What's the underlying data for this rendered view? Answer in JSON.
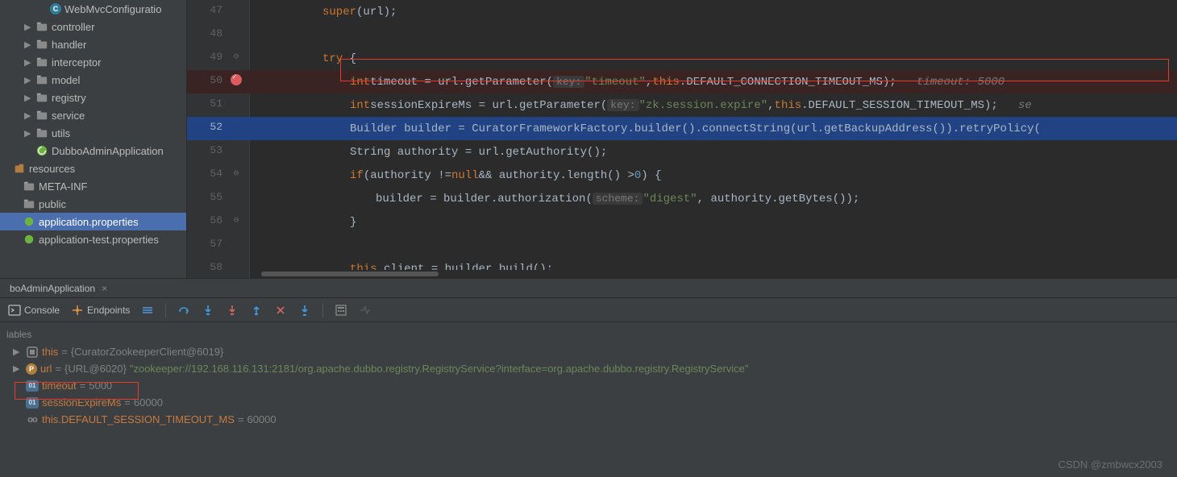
{
  "sidebar": {
    "items": [
      {
        "label": "WebMvcConfiguratio"
      },
      {
        "label": "controller"
      },
      {
        "label": "handler"
      },
      {
        "label": "interceptor"
      },
      {
        "label": "model"
      },
      {
        "label": "registry"
      },
      {
        "label": "service"
      },
      {
        "label": "utils"
      },
      {
        "label": "DubboAdminApplication"
      }
    ],
    "resources_label": "resources",
    "meta_inf": "META-INF",
    "public_label": "public",
    "app_props": "application.properties",
    "app_test_props": "application-test.properties"
  },
  "editor": {
    "lines": {
      "47": "super(url);",
      "48": "",
      "49": "try {",
      "50_pre": "    int timeout = url.getParameter( ",
      "50_key": "key:",
      "50_str": "\"timeout\"",
      "50_mid": ", this.DEFAULT_CONNECTION_TIMEOUT_MS);   ",
      "50_hint": "timeout: 5000",
      "51_pre": "    int sessionExpireMs = url.getParameter( ",
      "51_key": "key:",
      "51_str": "\"zk.session.expire\"",
      "51_mid": ", this.DEFAULT_SESSION_TIMEOUT_MS);   ",
      "51_hint": "se",
      "52": "    Builder builder = CuratorFrameworkFactory.builder().connectString(url.getBackupAddress()).retryPolicy(",
      "53": "    String authority = url.getAuthority();",
      "54": "    if (authority != null && authority.length() > 0) {",
      "55_pre": "        builder = builder.authorization( ",
      "55_key": "scheme:",
      "55_str": "\"digest\"",
      "55_post": ", authority.getBytes());",
      "56": "    }",
      "57": "",
      "58": "    this.client = builder.build();"
    },
    "line_numbers": [
      "47",
      "48",
      "49",
      "50",
      "51",
      "52",
      "53",
      "54",
      "55",
      "56",
      "57",
      "58"
    ]
  },
  "debug_tab": {
    "run_config": "boAdminApplication"
  },
  "toolbar": {
    "console": "Console",
    "endpoints": "Endpoints"
  },
  "variables": {
    "header": "iables",
    "rows": [
      {
        "ico": "ring",
        "name": "this",
        "val": "{CuratorZookeeperClient@6019}",
        "arrow": true
      },
      {
        "ico": "p",
        "name": "url",
        "val": "{URL@6020}",
        "str": " \"zookeeper://192.168.116.131:2181/org.apache.dubbo.registry.RegistryService?interface=org.apache.dubbo.registry.RegistryService\"",
        "arrow": true
      },
      {
        "ico": "01",
        "name": "timeout",
        "val": "5000",
        "arrow": false,
        "highlight": true
      },
      {
        "ico": "01",
        "name": "sessionExpireMs",
        "val": "60000",
        "arrow": false
      },
      {
        "ico": "oo",
        "name": "this.DEFAULT_SESSION_TIMEOUT_MS",
        "val": "60000",
        "arrow": false
      }
    ]
  },
  "watermark": "CSDN @zmbwcx2003"
}
